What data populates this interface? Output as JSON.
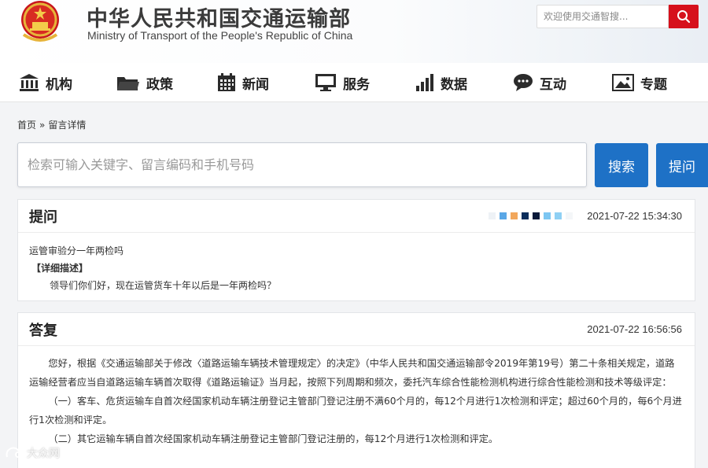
{
  "header": {
    "title": "中华人民共和国交通运输部",
    "subtitle": "Ministry of Transport of the People's Republic of China",
    "search_placeholder": "欢迎使用交通智搜...",
    "search_icon": "search-icon",
    "emblem_icon": "national-emblem-icon"
  },
  "nav": {
    "items": [
      {
        "label": "机构",
        "icon": "building-icon"
      },
      {
        "label": "政策",
        "icon": "folder-icon"
      },
      {
        "label": "新闻",
        "icon": "calendar-grid-icon"
      },
      {
        "label": "服务",
        "icon": "monitor-icon"
      },
      {
        "label": "数据",
        "icon": "bar-chart-icon"
      },
      {
        "label": "互动",
        "icon": "chat-bubble-icon"
      },
      {
        "label": "专题",
        "icon": "image-icon"
      }
    ]
  },
  "breadcrumb": {
    "home": "首页",
    "separator": "»",
    "current": "留言详情"
  },
  "search": {
    "placeholder": "检索可输入关键字、留言编码和手机号码",
    "search_label": "搜索",
    "ask_label": "提问"
  },
  "question": {
    "heading": "提问",
    "timestamp": "2021-07-22 15:34:30",
    "title": "运管审验分一年两检吗",
    "detail_label": "【详细描述】",
    "detail_text": "领导们你们好，现在运管货车十年以后是一年两检吗？"
  },
  "answer": {
    "heading": "答复",
    "timestamp": "2021-07-22 16:56:56",
    "para1": "您好，根据《交通运输部关于修改〈道路运输车辆技术管理规定〉的决定》（中华人民共和国交通运输部令2019年第19号）第二十条相关规定，道路运输经营者应当自道路运输车辆首次取得《道路运输证》当月起，按照下列周期和频次，委托汽车综合性能检测机构进行综合性能检测和技术等级评定：",
    "para2": "（一）客车、危货运输车自首次经国家机动车辆注册登记主管部门登记注册不满60个月的，每12个月进行1次检测和评定；超过60个月的，每6个月进行1次检测和评定。",
    "para3": "（二）其它运输车辆自首次经国家机动车辆注册登记主管部门登记注册的，每12个月进行1次检测和评定。"
  },
  "watermark": {
    "text": "大众网"
  },
  "colors": {
    "accent_blue": "#1e71c6",
    "search_red": "#d6111c",
    "redacted": [
      "#eef2f6",
      "#5aa7e6",
      "#f2a75c",
      "#0b2e5c",
      "#0a1a3a",
      "#7cc6f2",
      "#8fd0f4",
      "#f4f6f8"
    ]
  }
}
